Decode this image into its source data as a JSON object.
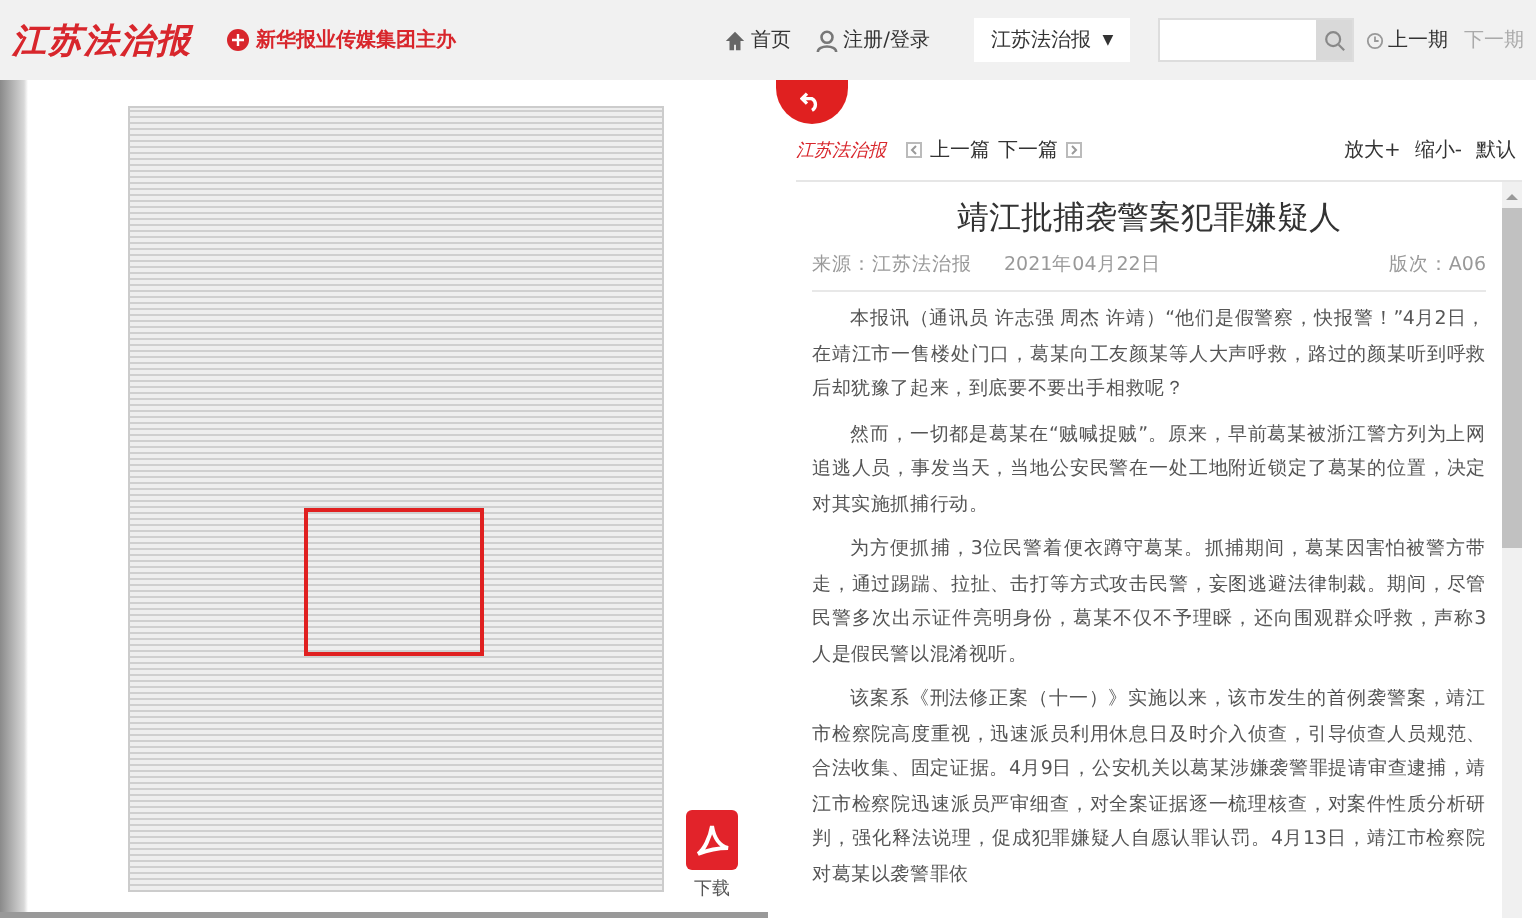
{
  "header": {
    "logo": "江苏法治报",
    "sponsor": "新华报业传媒集团主办",
    "nav": [
      {
        "kind": "home",
        "label": "首页"
      },
      {
        "kind": "user",
        "label": "注册/登录"
      }
    ],
    "paper_select": {
      "value": "江苏法治报",
      "arrow": "▼"
    },
    "issue_nav": [
      {
        "label": "上一期",
        "disabled": false
      },
      {
        "label": "下一期",
        "disabled": true
      }
    ]
  },
  "page_viewer": {
    "highlight": true,
    "download": "下载"
  },
  "article": {
    "logo": "江苏法治报",
    "prev": "上一篇",
    "next": "下一篇",
    "zoom": [
      "放大+",
      "缩小-",
      "默认"
    ],
    "title": "靖江批捕袭警案犯罪嫌疑人",
    "source": "来源：江苏法治报",
    "date": "2021年04月22日",
    "edition": "版次：A06",
    "paragraphs": [
      "本报讯（通讯员 许志强 周杰 许靖）“他们是假警察，快报警！”4月2日，在靖江市一售楼处门口，葛某向工友颜某等人大声呼救，路过的颜某听到呼救后却犹豫了起来，到底要不要出手相救呢？",
      "然而，一切都是葛某在“贼喊捉贼”。原来，早前葛某被浙江警方列为上网追逃人员，事发当天，当地公安民警在一处工地附近锁定了葛某的位置，决定对其实施抓捕行动。",
      "为方便抓捕，3位民警着便衣蹲守葛某。抓捕期间，葛某因害怕被警方带走，通过踢踹、拉扯、击打等方式攻击民警，妄图逃避法律制裁。期间，尽管民警多次出示证件亮明身份，葛某不仅不予理睬，还向围观群众呼救，声称3人是假民警以混淆视听。",
      "该案系《刑法修正案（十一）》实施以来，该市发生的首例袭警案，靖江市检察院高度重视，迅速派员利用休息日及时介入侦查，引导侦查人员规范、合法收集、固定证据。4月9日，公安机关以葛某涉嫌袭警罪提请审查逮捕，靖江市检察院迅速派员严审细查，对全案证据逐一梳理核查，对案件性质分析研判，强化释法说理，促成犯罪嫌疑人自愿认罪认罚。4月13日，靖江市检察院对葛某以袭警罪依"
    ]
  }
}
